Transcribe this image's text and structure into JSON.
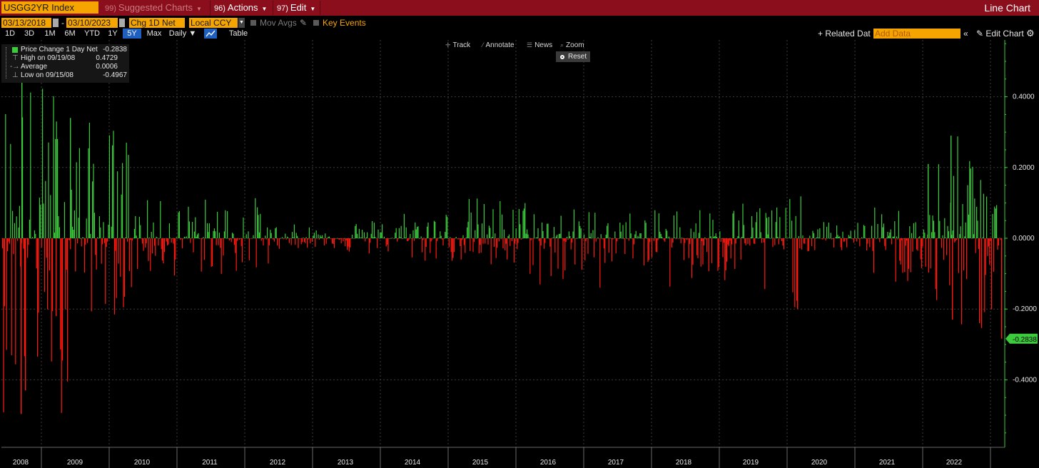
{
  "header": {
    "ticker": "USGG2YR Index",
    "menu": [
      {
        "num": "99)",
        "label": "Suggested Charts",
        "dim": true
      },
      {
        "num": "96)",
        "label": "Actions",
        "dim": false
      },
      {
        "num": "97)",
        "label": "Edit",
        "dim": false
      }
    ],
    "chart_title": "Line Chart"
  },
  "options": {
    "start_date": "03/13/2018",
    "dash": "-",
    "end_date": "03/10/2023",
    "field": "Chg 1D Net",
    "currency": "Local CCY",
    "mov_avgs": "Mov Avgs",
    "key_events": "Key Events"
  },
  "ranges": {
    "buttons": [
      "1D",
      "3D",
      "1M",
      "6M",
      "YTD",
      "1Y",
      "5Y",
      "Max"
    ],
    "active": "5Y",
    "period": "Daily",
    "table": "Table",
    "related_label": "Related Dat",
    "add_data_placeholder": "Add Data",
    "edit_chart": "Edit Chart"
  },
  "toolbar": {
    "track": "Track",
    "annotate": "Annotate",
    "news": "News",
    "zoom": "Zoom",
    "reset": "Reset"
  },
  "legend": {
    "series": {
      "label": "Price Change 1 Day Net",
      "value": "-0.2838"
    },
    "high": {
      "label": "High on 09/19/08",
      "value": "0.4729"
    },
    "average": {
      "label": "Average",
      "value": "0.0006"
    },
    "low": {
      "label": "Low on 09/15/08",
      "value": "-0.4967"
    }
  },
  "colors": {
    "positive": "#3ccb3c",
    "negative": "#ff1a10",
    "axis": "#3ccb3c",
    "accent": "#f5a400",
    "header": "#8b0e1c"
  },
  "chart_data": {
    "type": "bar",
    "series_name": "Price Change 1 Day Net",
    "last_value": "-0.2838",
    "ylim": [
      -0.58,
      0.55
    ],
    "yticks": [
      "0.4000",
      "0.2000",
      "0.0000",
      "-0.2000",
      "-0.4000"
    ],
    "ytick_values": [
      0.4,
      0.2,
      0.0,
      -0.2,
      -0.4
    ],
    "x_year_labels": [
      "2008",
      "2009",
      "2010",
      "2011",
      "2012",
      "2013",
      "2014",
      "2015",
      "2016",
      "2017",
      "2018",
      "2019",
      "2020",
      "2021",
      "2022"
    ],
    "grid": true,
    "approx_yearly_ranges": [
      {
        "year": "2008",
        "max": 0.4729,
        "min": -0.4967
      },
      {
        "year": "2009",
        "max": 0.34,
        "min": -0.22
      },
      {
        "year": "2010",
        "max": 0.11,
        "min": -0.11
      },
      {
        "year": "2011",
        "max": 0.12,
        "min": -0.11
      },
      {
        "year": "2012",
        "max": 0.04,
        "min": -0.03
      },
      {
        "year": "2013",
        "max": 0.06,
        "min": -0.05
      },
      {
        "year": "2014",
        "max": 0.09,
        "min": -0.07
      },
      {
        "year": "2015",
        "max": 0.12,
        "min": -0.11
      },
      {
        "year": "2016",
        "max": 0.09,
        "min": -0.15
      },
      {
        "year": "2017",
        "max": 0.08,
        "min": -0.08
      },
      {
        "year": "2018",
        "max": 0.1,
        "min": -0.15
      },
      {
        "year": "2019",
        "max": 0.12,
        "min": -0.2
      },
      {
        "year": "2020",
        "max": 0.05,
        "min": -0.04
      },
      {
        "year": "2021",
        "max": 0.09,
        "min": -0.14
      },
      {
        "year": "2022",
        "max": 0.29,
        "min": -0.28
      }
    ]
  }
}
